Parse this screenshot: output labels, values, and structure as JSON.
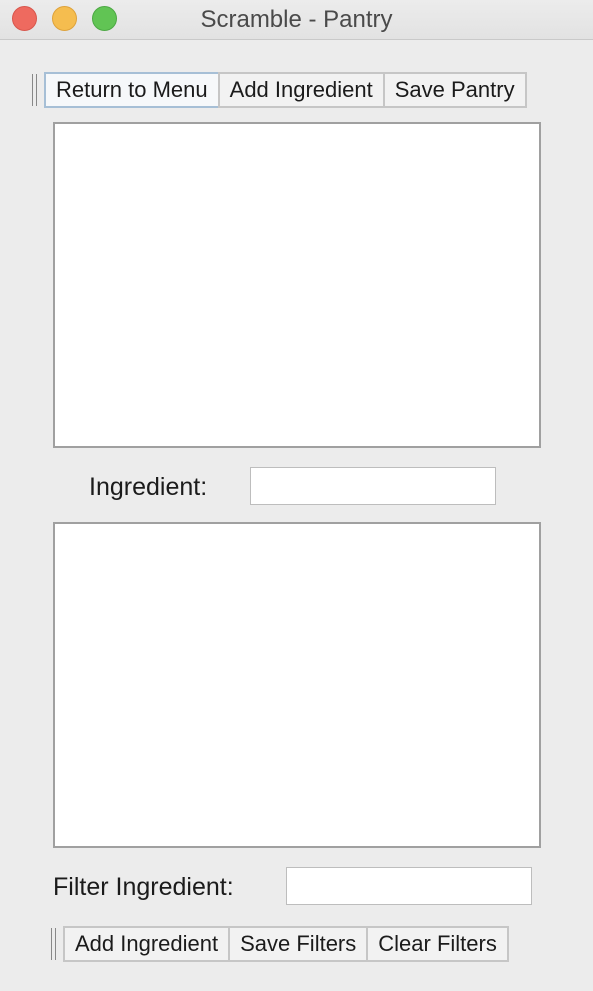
{
  "window": {
    "title": "Scramble - Pantry"
  },
  "top_toolbar": {
    "return_label": "Return to Menu",
    "add_label": "Add Ingredient",
    "save_label": "Save Pantry"
  },
  "pantry_list": {
    "items": []
  },
  "ingredient_field": {
    "label": "Ingredient:",
    "value": ""
  },
  "filter_list": {
    "items": []
  },
  "filter_field": {
    "label": "Filter Ingredient:",
    "value": ""
  },
  "bottom_toolbar": {
    "add_label": "Add Ingredient",
    "save_label": "Save Filters",
    "clear_label": "Clear Filters"
  },
  "colors": {
    "close": "#ee6a5f",
    "minimize": "#f5bd4f",
    "maximize": "#61c454",
    "window_bg": "#ececec"
  }
}
